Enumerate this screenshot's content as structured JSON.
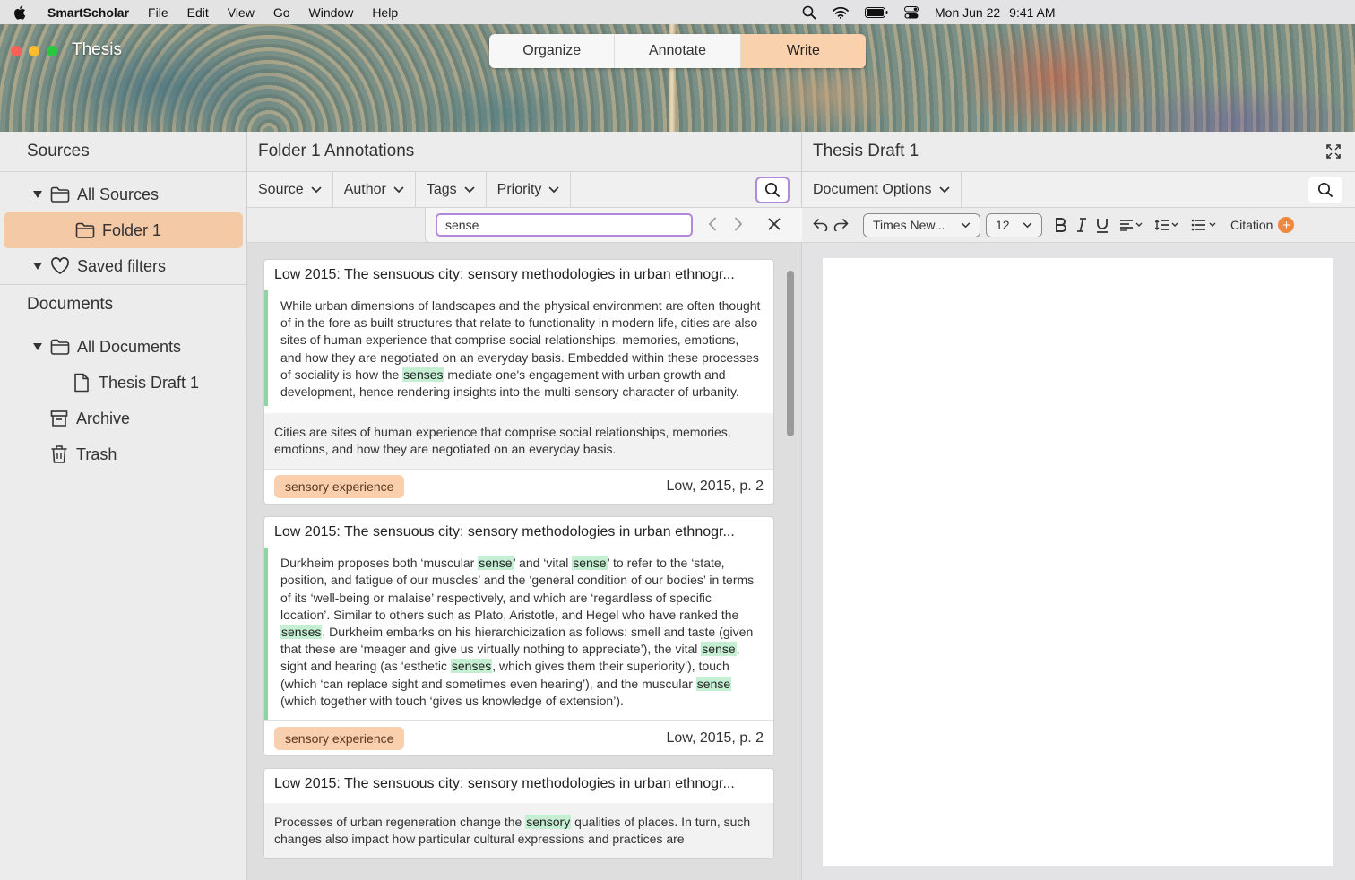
{
  "menubar": {
    "app_name": "SmartScholar",
    "menus": [
      "File",
      "Edit",
      "View",
      "Go",
      "Window",
      "Help"
    ],
    "date": "Mon Jun 22",
    "time": "9:41 AM"
  },
  "window": {
    "title": "Thesis",
    "modes": [
      "Organize",
      "Annotate",
      "Write"
    ],
    "active_mode": "Write"
  },
  "sidebar": {
    "sources_header": "Sources",
    "all_sources": "All Sources",
    "folder1": "Folder 1",
    "saved_filters": "Saved filters",
    "documents_header": "Documents",
    "all_documents": "All Documents",
    "thesis_draft": "Thesis Draft 1",
    "archive": "Archive",
    "trash": "Trash"
  },
  "annotations": {
    "title": "Folder 1 Annotations",
    "filters": [
      "Source",
      "Author",
      "Tags",
      "Priority"
    ],
    "search_query": "sense",
    "cards": [
      {
        "title": "Low 2015: The sensuous city: sensory methodologies in urban ethnogr...",
        "quote_before": "While urban dimensions of landscapes and the physical environment are often thought of in the fore as built structures that relate to functionality in modern life, cities are also sites of human experience that comprise social relationships, memories, emotions, and how they are negotiated on an everyday basis. Embedded within these processes of sociality is how the ",
        "quote_mark": "senses",
        "quote_after": " mediate one's engagement with urban growth and development, hence rendering insights into the multi-sensory character of urbanity.",
        "note": "Cities are sites of human experience that comprise social relationships, memories, emotions, and how they are negotiated on an everyday basis.",
        "tag": "sensory experience",
        "citation": "Low, 2015, p. 2"
      },
      {
        "title": "Low 2015: The sensuous city: sensory methodologies in urban ethnogr...",
        "segments": [
          "Durkheim proposes both ‘muscular ",
          "sense",
          "’ and ‘vital ",
          "sense",
          "’ to refer to the ‘state, position, and fatigue of our muscles’ and the ‘general condition of our bodies’ in terms of its ‘well-being or malaise’ respectively, and which are ‘regardless of specific location’. Similar to others such as Plato, Aristotle, and Hegel who have ranked the ",
          "senses",
          ", Durkheim embarks on his hierarchicization as follows: smell and taste (given that these are ‘meager and give us virtually nothing to appreciate’), the vital ",
          "sense",
          ", sight and hearing (as ‘esthetic ",
          "senses",
          ", which gives them their superiority’), touch (which ‘can replace sight and sometimes even hearing’), and the muscular ",
          "sense",
          " (which together with touch ‘gives us knowledge of extension’)."
        ],
        "tag": "sensory experience",
        "citation": "Low, 2015, p. 2"
      },
      {
        "title": "Low 2015: The sensuous city: sensory methodologies in urban ethnogr...",
        "note_before": "Processes of urban regeneration change the ",
        "note_mark": "sensory",
        "note_after": " qualities of places. In turn, such changes also impact how particular cultural expressions and practices are"
      }
    ]
  },
  "editor": {
    "title": "Thesis Draft 1",
    "document_options": "Document Options",
    "font": "Times New...",
    "size": "12",
    "citation": "Citation",
    "citation_add": "+"
  },
  "colors": {
    "accent": "#f9d1ad",
    "highlight": "#c5efd3",
    "quote_bar": "#8ed6a0",
    "search_focus": "#b08ad8",
    "citation_plus": "#f0883e"
  }
}
